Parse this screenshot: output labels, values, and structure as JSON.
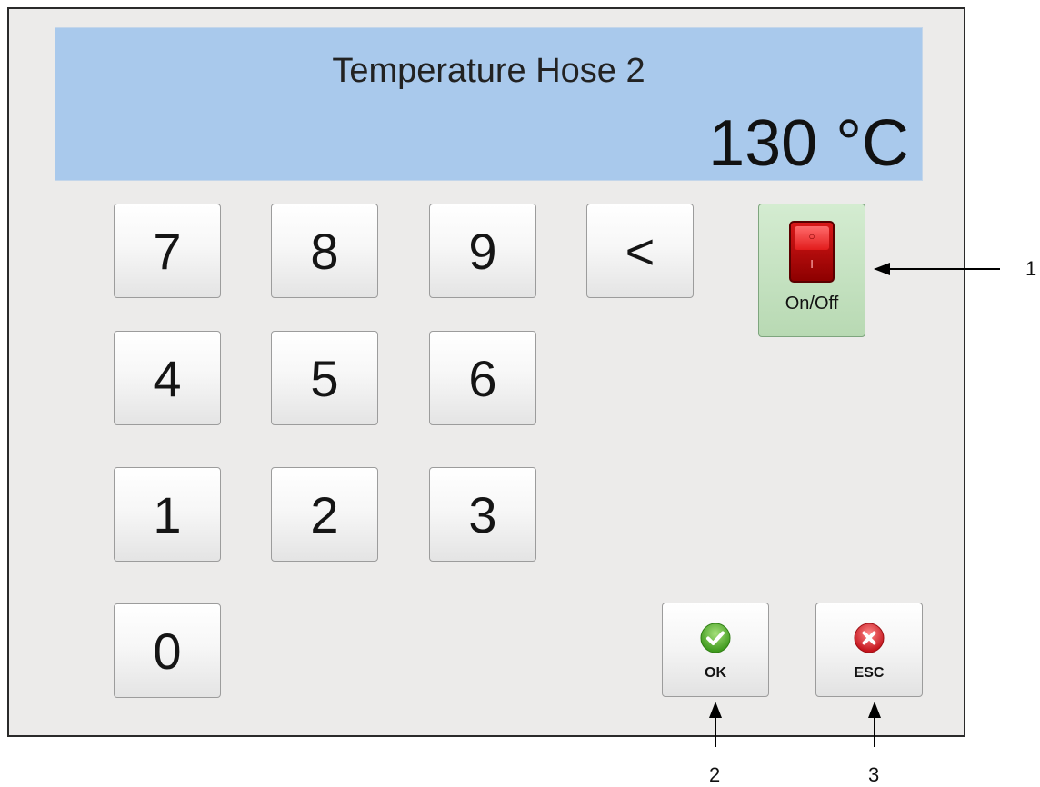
{
  "display": {
    "title": "Temperature Hose 2",
    "value": "130 °C",
    "background_color": "#a9c9ec"
  },
  "keypad": {
    "keys": [
      "7",
      "8",
      "9",
      "<",
      "4",
      "5",
      "6",
      "1",
      "2",
      "3",
      "0"
    ]
  },
  "power_switch": {
    "label": "On/Off",
    "icon": "rocker-switch-icon",
    "symbol_off": "○",
    "symbol_on": "I",
    "color": "#d81818"
  },
  "actions": {
    "ok_label": "OK",
    "ok_icon": "checkmark-icon",
    "ok_color": "#5cb82e",
    "esc_label": "ESC",
    "esc_icon": "x-icon",
    "esc_color": "#d9282e"
  },
  "callouts": {
    "one": "1",
    "two": "2",
    "three": "3"
  }
}
